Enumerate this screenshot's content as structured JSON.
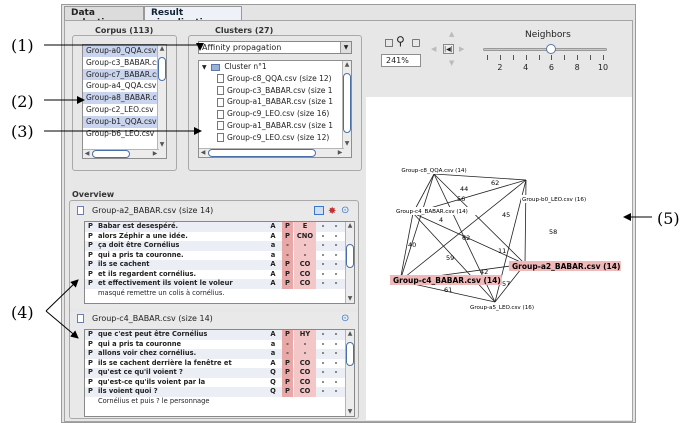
{
  "tabs": [
    {
      "label": "Data selection",
      "active": false
    },
    {
      "label": "Result visualization",
      "active": true
    }
  ],
  "callouts": [
    "(1)",
    "(2)",
    "(3)",
    "(4)",
    "(5)"
  ],
  "corpus": {
    "title": "Corpus (113)",
    "items": [
      {
        "label": "Group-a0_QQA.csv",
        "selected": true
      },
      {
        "label": "Group-c3_BABAR.csv",
        "selected": false
      },
      {
        "label": "Group-c7_BABAR.csv",
        "selected": true
      },
      {
        "label": "Group-a4_QQA.csv",
        "selected": false
      },
      {
        "label": "Group-a8_BABAR.csv",
        "selected": true
      },
      {
        "label": "Group-c2_LEO.csv",
        "selected": false
      },
      {
        "label": "Group-b1_QQA.csv",
        "selected": true
      },
      {
        "label": "Group-b6_LEO.csv",
        "selected": false
      }
    ]
  },
  "clusters": {
    "title": "Clusters (27)",
    "algorithm": "Affinity propagation",
    "cluster_name": "Cluster n°1",
    "files": [
      "Group-c8_QQA.csv (size 12)",
      "Group-c3_BABAR.csv (size 1",
      "Group-a1_BABAR.csv (size 1",
      "Group-c9_LEO.csv (size 16)",
      "Group-a1_BABAR.csv (size 1",
      "Group-c9_LEO.csv (size 12)"
    ]
  },
  "toolbar": {
    "zoom": "241%",
    "neighbors_label": "Neighbors",
    "neighbors_value": 6,
    "neighbors_min": 1,
    "neighbors_max": 10,
    "ticks": [
      "2",
      "4",
      "6",
      "8",
      "10"
    ]
  },
  "overview": {
    "title": "Overview",
    "docs": [
      {
        "name": "Group-a2_BABAR.csv (size 14)",
        "rows": [
          [
            "P",
            "Babar est desespéré.",
            "A",
            "P",
            "E",
            "-",
            "-"
          ],
          [
            "P",
            "alors Zéphir a une idée.",
            "A",
            "P",
            "CNO",
            "-",
            "-"
          ],
          [
            "P",
            "ça doit être Cornélius",
            "a",
            "-",
            "-",
            "-",
            "-"
          ],
          [
            "P",
            "qui a pris ta couronne.",
            "a",
            "-",
            "-",
            "-",
            "-"
          ],
          [
            "P",
            "ils se cachent",
            "A",
            "P",
            "CO",
            "-",
            "-"
          ],
          [
            "P",
            "et ils regardent cornélius.",
            "A",
            "P",
            "CO",
            "-",
            "-"
          ],
          [
            "P",
            "et effectivement ils voient le voleur",
            "A",
            "P",
            "CO",
            "-",
            "-"
          ],
          [
            "",
            "masqué remettre un colis à cornélius.",
            "",
            "",
            "",
            "",
            ""
          ]
        ]
      },
      {
        "name": "Group-c4_BABAR.csv (size 14)",
        "rows": [
          [
            "P",
            "que c'est peut être Cornélius",
            "A",
            "P",
            "HY",
            "-",
            "-"
          ],
          [
            "P",
            "qui a pris ta couronne",
            "a",
            "-",
            "-",
            "-",
            "-"
          ],
          [
            "P",
            "allons voir chez cornélius.",
            "a",
            "-",
            "-",
            "-",
            "-"
          ],
          [
            "P",
            "ils se cachent derrière la fenêtre et",
            "A",
            "P",
            "CO",
            "-",
            "-"
          ],
          [
            "P",
            "qu'est ce qu'il voient ?",
            "Q",
            "P",
            "CO",
            "-",
            "-"
          ],
          [
            "P",
            "qu'est-ce qu'ils voient par la",
            "Q",
            "P",
            "CO",
            "-",
            "-"
          ],
          [
            "P",
            "ils voient quoi ?",
            "Q",
            "P",
            "CO",
            "-",
            "-"
          ],
          [
            "",
            "Cornélius et puis ? le personnage",
            "",
            "",
            "",
            "",
            ""
          ]
        ]
      }
    ]
  },
  "graph": {
    "nodes": [
      {
        "label": "Group-c8_QQA.csv (14)",
        "highlight": false
      },
      {
        "label": "Group-b0_LEO.csv (16)",
        "highlight": false
      },
      {
        "label": "Group-c4_BABAR.csv (14)",
        "highlight": false
      },
      {
        "label": "Group-a2_BABAR.csv (14)",
        "highlight": true
      },
      {
        "label": "Group-c4_BABAR.csv (14)",
        "highlight": true
      },
      {
        "label": "Group-a5_LEO.csv (16)",
        "highlight": false
      }
    ],
    "edge_labels": [
      "44",
      "62",
      "56",
      "45",
      "4",
      "62",
      "58",
      "40",
      "59",
      "11",
      "42",
      "61",
      "57"
    ]
  },
  "colors": {
    "selection": "#c9d4ee",
    "highlight": "#f0b8b8",
    "accent_cell": "#e8a8a8"
  }
}
